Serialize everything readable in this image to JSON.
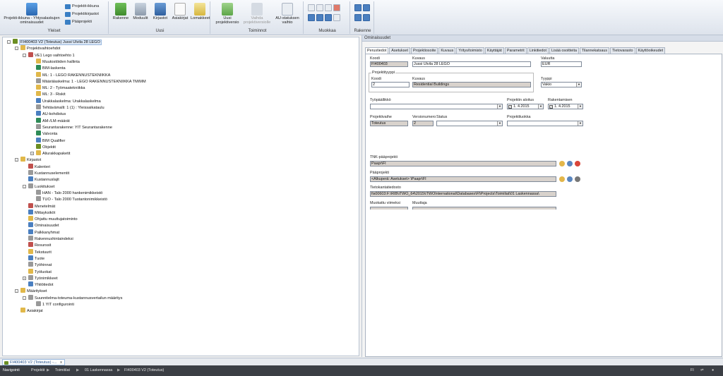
{
  "ribbon": {
    "groups": [
      {
        "label": "Yleiset",
        "buttons": [
          "Projekti-ikkuna - Yhtysalaskujen ominaisuudet",
          "Projektit-ikkuna",
          "Projektikirjastot",
          "Pääprojekti"
        ]
      },
      {
        "label": "Uusi",
        "buttons": [
          "Rakenne",
          "Moduulit",
          "Kirjastot",
          "Asiakirjat",
          "Lomakkeet"
        ]
      },
      {
        "label": "Toiminnot",
        "buttons": [
          "Uusi projektiversio",
          "Vaihda projektiversiolle",
          "AU-statuksen vaihto"
        ]
      },
      {
        "label": "Muokkaa",
        "buttons": []
      },
      {
        "label": "Rakenne",
        "buttons": []
      }
    ]
  },
  "tree": {
    "items": [
      {
        "label": "FI400403 V2 (Toteutus) Jussi Ulvila 28 LEGO",
        "level": 0,
        "expander": "-",
        "color": "#6b8e23",
        "selected": true
      },
      {
        "label": "Projektivaihtoehdot",
        "level": 1,
        "expander": "-",
        "color": "#e1b84a"
      },
      {
        "label": "VE1 Lego vaihtoehto 1",
        "level": 2,
        "expander": "-",
        "color": "#c0504d"
      },
      {
        "label": "Muutostöiden hallinta",
        "level": 3,
        "color": "#e1b84a"
      },
      {
        "label": "BIM-laskenta",
        "level": 3,
        "color": "#2e8b57"
      },
      {
        "label": "ML: 1 - LEGO RAKENNUSTEKNIIKKA",
        "level": 3,
        "color": "#e1b84a"
      },
      {
        "label": "Määrälaskelma: 1 - LEGO RAKENNUSTEKNIIKKA TM/MM",
        "level": 3,
        "color": "#999999"
      },
      {
        "label": "ML: 2 - Työmaatekniikka",
        "level": 3,
        "color": "#e1b84a"
      },
      {
        "label": "ML: 3 - Riskit",
        "level": 3,
        "color": "#e1b84a"
      },
      {
        "label": "Urakkalaskelma: Urakkalaskelma",
        "level": 3,
        "color": "#4a7fc0"
      },
      {
        "label": "Tehtävämalli: 1 (1) : Yleissaikataulu",
        "level": 3,
        "color": "#999999"
      },
      {
        "label": "AU-kohdistus",
        "level": 3,
        "color": "#4a7fc0"
      },
      {
        "label": "AM-/LM-määrät",
        "level": 3,
        "color": "#2e8b57"
      },
      {
        "label": "Seurantarakenne: YIT Seurantarakenne",
        "level": 3,
        "color": "#999999"
      },
      {
        "label": "Valvonta",
        "level": 3,
        "color": "#2e8b57"
      },
      {
        "label": "BIM Qualifier",
        "level": 3,
        "color": "#4a7fc0"
      },
      {
        "label": "Objektit",
        "level": 3,
        "color": "#6b8e23"
      },
      {
        "label": "Aliurakkapaketit",
        "level": 3,
        "expander": "+",
        "color": "#e1b84a"
      },
      {
        "label": "Kirjastot",
        "level": 1,
        "expander": "-",
        "color": "#e1b84a"
      },
      {
        "label": "Kalenteri",
        "level": 2,
        "color": "#c0504d"
      },
      {
        "label": "Kustannuselementit",
        "level": 2,
        "color": "#999999"
      },
      {
        "label": "Kustannuslajit",
        "level": 2,
        "color": "#4a7fc0"
      },
      {
        "label": "Luokitukset",
        "level": 2,
        "expander": "-",
        "color": "#999999"
      },
      {
        "label": "HAN - Talo 2000 hankenimikkeistö",
        "level": 3,
        "color": "#999999"
      },
      {
        "label": "TUO - Talo 2000 Tuotantonimikkeistö",
        "level": 3,
        "color": "#999999"
      },
      {
        "label": "Menetelmät",
        "level": 2,
        "color": "#c0504d"
      },
      {
        "label": "Mittayksiköt",
        "level": 2,
        "color": "#4a7fc0"
      },
      {
        "label": "Ohjattu muuttujatoiminto",
        "level": 2,
        "color": "#e1b84a"
      },
      {
        "label": "Ominaisuudet",
        "level": 2,
        "color": "#4a7fc0"
      },
      {
        "label": "Palkkanyhmat",
        "level": 2,
        "color": "#4a7fc0"
      },
      {
        "label": "Rakennushintaindeksi",
        "level": 2,
        "color": "#999999"
      },
      {
        "label": "Resurssit",
        "level": 2,
        "color": "#c0504d"
      },
      {
        "label": "Tekstuurit",
        "level": 2,
        "color": "#e1b84a"
      },
      {
        "label": "Tuote",
        "level": 2,
        "color": "#4a7fc0"
      },
      {
        "label": "Työhinnat",
        "level": 2,
        "color": "#999999"
      },
      {
        "label": "Työluokat",
        "level": 2,
        "color": "#e1b84a"
      },
      {
        "label": "Työnimikkeet",
        "level": 2,
        "expander": "+",
        "color": "#999999"
      },
      {
        "label": "Yhtiötiedot",
        "level": 2,
        "color": "#4a7fc0"
      },
      {
        "label": "Määritykset",
        "level": 1,
        "expander": "-",
        "color": "#e1b84a"
      },
      {
        "label": "Suunnitelma-toteuma-kustannusvertailun määritys",
        "level": 2,
        "expander": "-",
        "color": "#999999"
      },
      {
        "label": "1 YIT configurointi",
        "level": 3,
        "color": "#999999"
      },
      {
        "label": "Asiakirjat",
        "level": 1,
        "color": "#e1b84a"
      }
    ]
  },
  "properties": {
    "title": "Ominaisuudet",
    "tabs": [
      "Perustiedot",
      "Asetukset",
      "Projektiosoite",
      "Kuvaus",
      "Yritys/toimisto",
      "Käyttäjät",
      "Parametrit",
      "Linkitiedot",
      "Lisää osoitteita",
      "Tilannekatsaus",
      "Tietovarasto",
      "Käyttöoikeudet"
    ],
    "koodi_label": "Koodi",
    "koodi_value": "FI400403",
    "kuvaus_label": "Kuvaus",
    "kuvaus_value": "Jussi Ulvila 28 LEGO",
    "valuutta_label": "Valuutta",
    "valuutta_value": "EUR",
    "projektityyppi_label": "Projektityyppi",
    "pt_koodi_label": "Koodi",
    "pt_koodi_value": "2",
    "pt_kuvaus_label": "Kuvaus",
    "pt_kuvaus_value": "Residential Buildings",
    "tyyppi_label": "Tyyppi",
    "tyyppi_value": "Vakio",
    "tyopaallikko_label": "Työpäällikkö",
    "tyopaallikko_value": "",
    "aloitus_label": "Projektin aloitus",
    "aloitus_value": "1. 4.2015",
    "rakentaminen_label": "Rakentamisen",
    "rakentaminen_value": "1. 4.2015",
    "vaihe_label": "Projektivaihe",
    "vaihe_value": "Toteutus",
    "versionumero_label": "Versionumero",
    "versionumero_value": "2",
    "status_label": "Status",
    "status_value": "",
    "projektiluokka_label": "Projektiluokka",
    "projektiluokka_value": "",
    "tnk_label": "TNK-pääprojekti",
    "tnk_value": "Paapr\\FI",
    "paaprojekti_label": "Pääprojekti",
    "paaprojekti_value": "<Alkuperä: Asetukset> \\Paapr\\FI",
    "tietokanta_label": "Tietokantatiedosto",
    "tietokanta_value": "fis00603:F:\\RIB\\iTWO_64\\2015\\iTWOInternational\\Databases\\FI\\Projects\\Toimiliat\\01 Laskennassa\\",
    "muokattu_label": "Muokattu viimeksi",
    "muuttaja_label": "Muuttaja"
  },
  "bottom_tab": {
    "label": "FI400403 V2 (Toteutus) -...",
    "close": "x"
  },
  "status": {
    "crumbs": [
      "Navigointi",
      "Projektit",
      "Toimitilat",
      "01 Laskennassa",
      "FI400403 V2 (Toteutus)"
    ],
    "lang": "FI"
  },
  "colors": {
    "accent": "#3a7fc4",
    "ribbon": "#dde3ec",
    "statusbar": "#3b3e44"
  }
}
